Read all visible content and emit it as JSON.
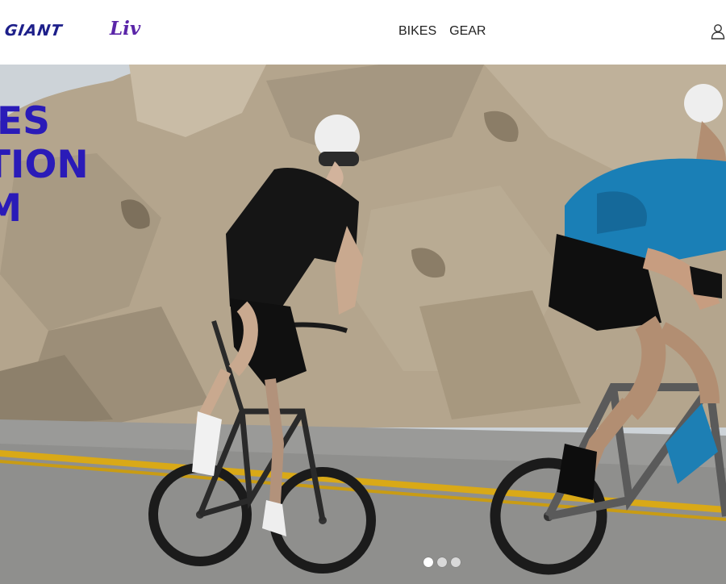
{
  "brand": {
    "logo_primary": "GIANT",
    "logo_secondary": "Liv"
  },
  "nav": {
    "items": [
      "BIKES",
      "GEAR"
    ]
  },
  "header_icons": {
    "account": "user-icon"
  },
  "hero": {
    "headline_lines": [
      "ES",
      "RATION",
      "AM"
    ],
    "carousel": {
      "slides": 3,
      "active_index": 0
    }
  },
  "colors": {
    "brand_blue": "#1d1f8a",
    "liv_purple": "#5a25a8",
    "headline_blue": "#2a1bb8",
    "road_line_yellow": "#d9a917"
  }
}
